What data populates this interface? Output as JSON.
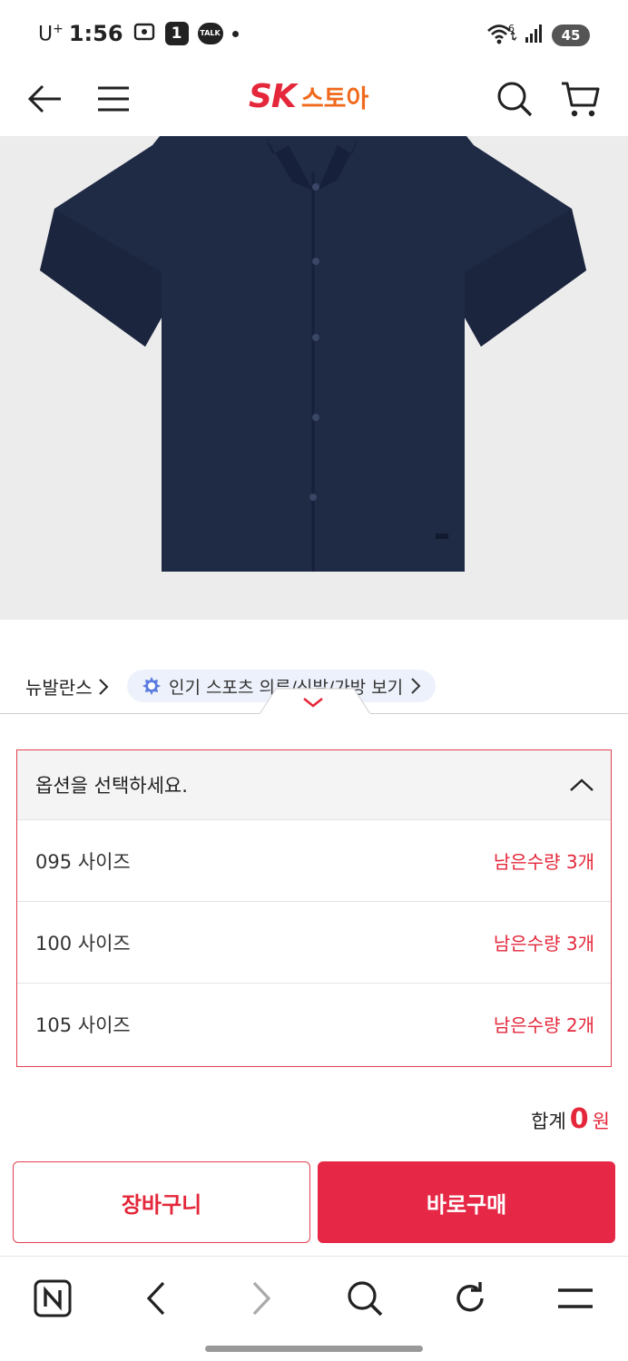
{
  "status_bar": {
    "carrier": "U",
    "carrier_sup": "+",
    "time": "1:56",
    "notification_count": "1",
    "talk_label": "TALK",
    "wifi_label": "6",
    "battery": "45"
  },
  "header": {
    "logo_sk": "SK",
    "logo_store": "스토아"
  },
  "brand": {
    "name": "뉴발란스",
    "category_link": "인기 스포츠 의류/신발/가방 보기"
  },
  "options": {
    "placeholder": "옵션을 선택하세요.",
    "items": [
      {
        "name": "095 사이즈",
        "stock": "남은수량 3개"
      },
      {
        "name": "100 사이즈",
        "stock": "남은수량 3개"
      },
      {
        "name": "105 사이즈",
        "stock": "남은수량 2개"
      }
    ]
  },
  "total": {
    "label": "합계",
    "value": "0",
    "unit": "원"
  },
  "actions": {
    "cart_label": "장바구니",
    "buy_label": "바로구매"
  },
  "browser": {
    "naver_label": "N"
  },
  "colors": {
    "accent": "#e4273a",
    "logo_orange": "#f06a1d",
    "shirt_navy": "#1f2a45"
  }
}
